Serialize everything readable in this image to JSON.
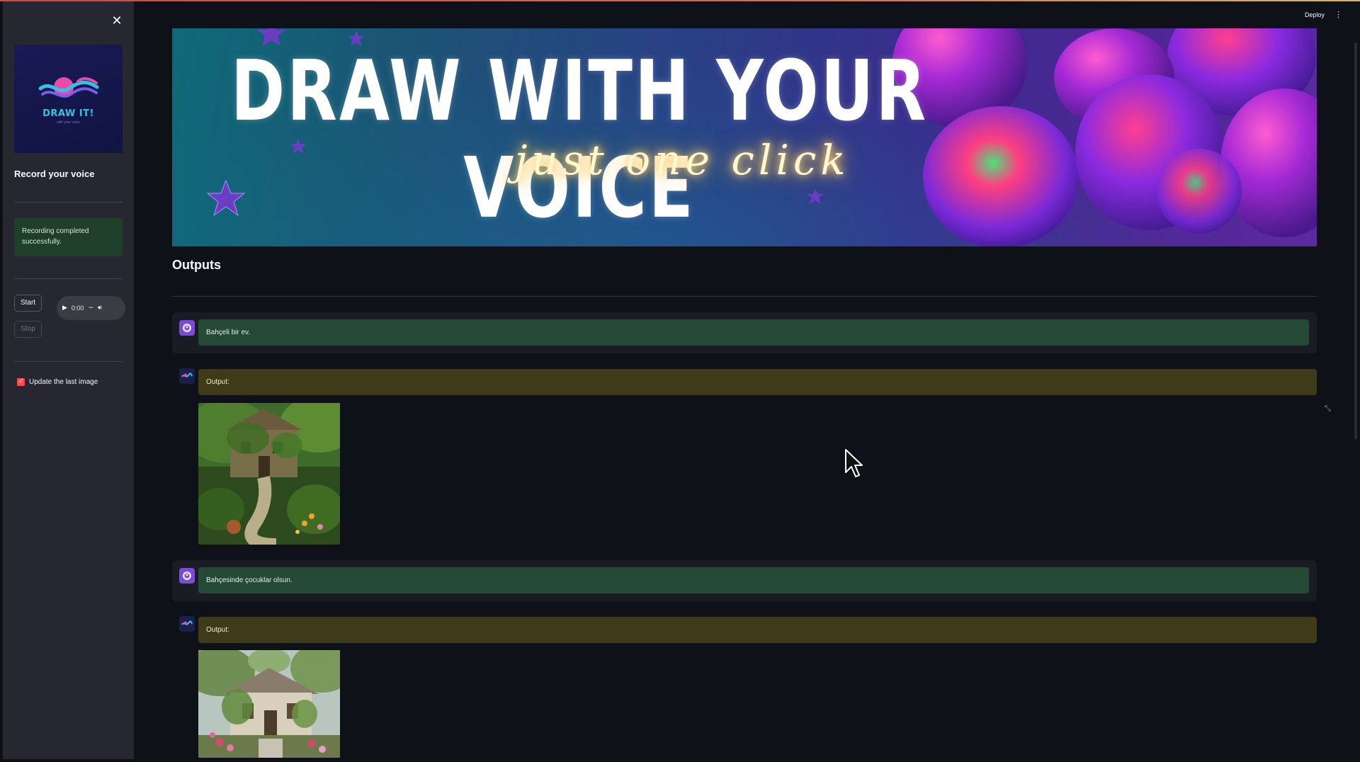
{
  "sidebar": {
    "close_icon": "close-icon",
    "logo": {
      "text": "DRAW IT!",
      "subtext": "with your voice"
    },
    "title": "Record your voice",
    "alert": "Recording completed successfully.",
    "start_label": "Start",
    "stop_label": "Stop",
    "audio": {
      "time": "0:00",
      "play_icon": "play-icon",
      "minus": "−",
      "volume_icon": "volume-icon"
    },
    "checkbox": {
      "label": "Update the last image",
      "checked": true
    }
  },
  "header": {
    "deploy_label": "Deploy",
    "menu_icon": "kebab-menu-icon"
  },
  "banner": {
    "title": "DRAW WITH YOUR VOICE",
    "subtitle": "just one click"
  },
  "main": {
    "title": "Outputs",
    "messages": [
      {
        "role": "user",
        "text": "Bahçeli bir ev."
      },
      {
        "role": "assistant",
        "text": "Output:",
        "image": "garden-house-image"
      },
      {
        "role": "user",
        "text": "Bahçesinde çocuklar olsun."
      },
      {
        "role": "assistant",
        "text": "Output:",
        "image": "cottage-image"
      }
    ]
  },
  "colors": {
    "accent": "#ff4b4b",
    "sidebar_bg": "#262730",
    "app_bg": "#0e1117",
    "user_bubble": "#244a35",
    "assistant_bubble": "#3f3a18",
    "alert_bg": "#1f3f2b"
  }
}
